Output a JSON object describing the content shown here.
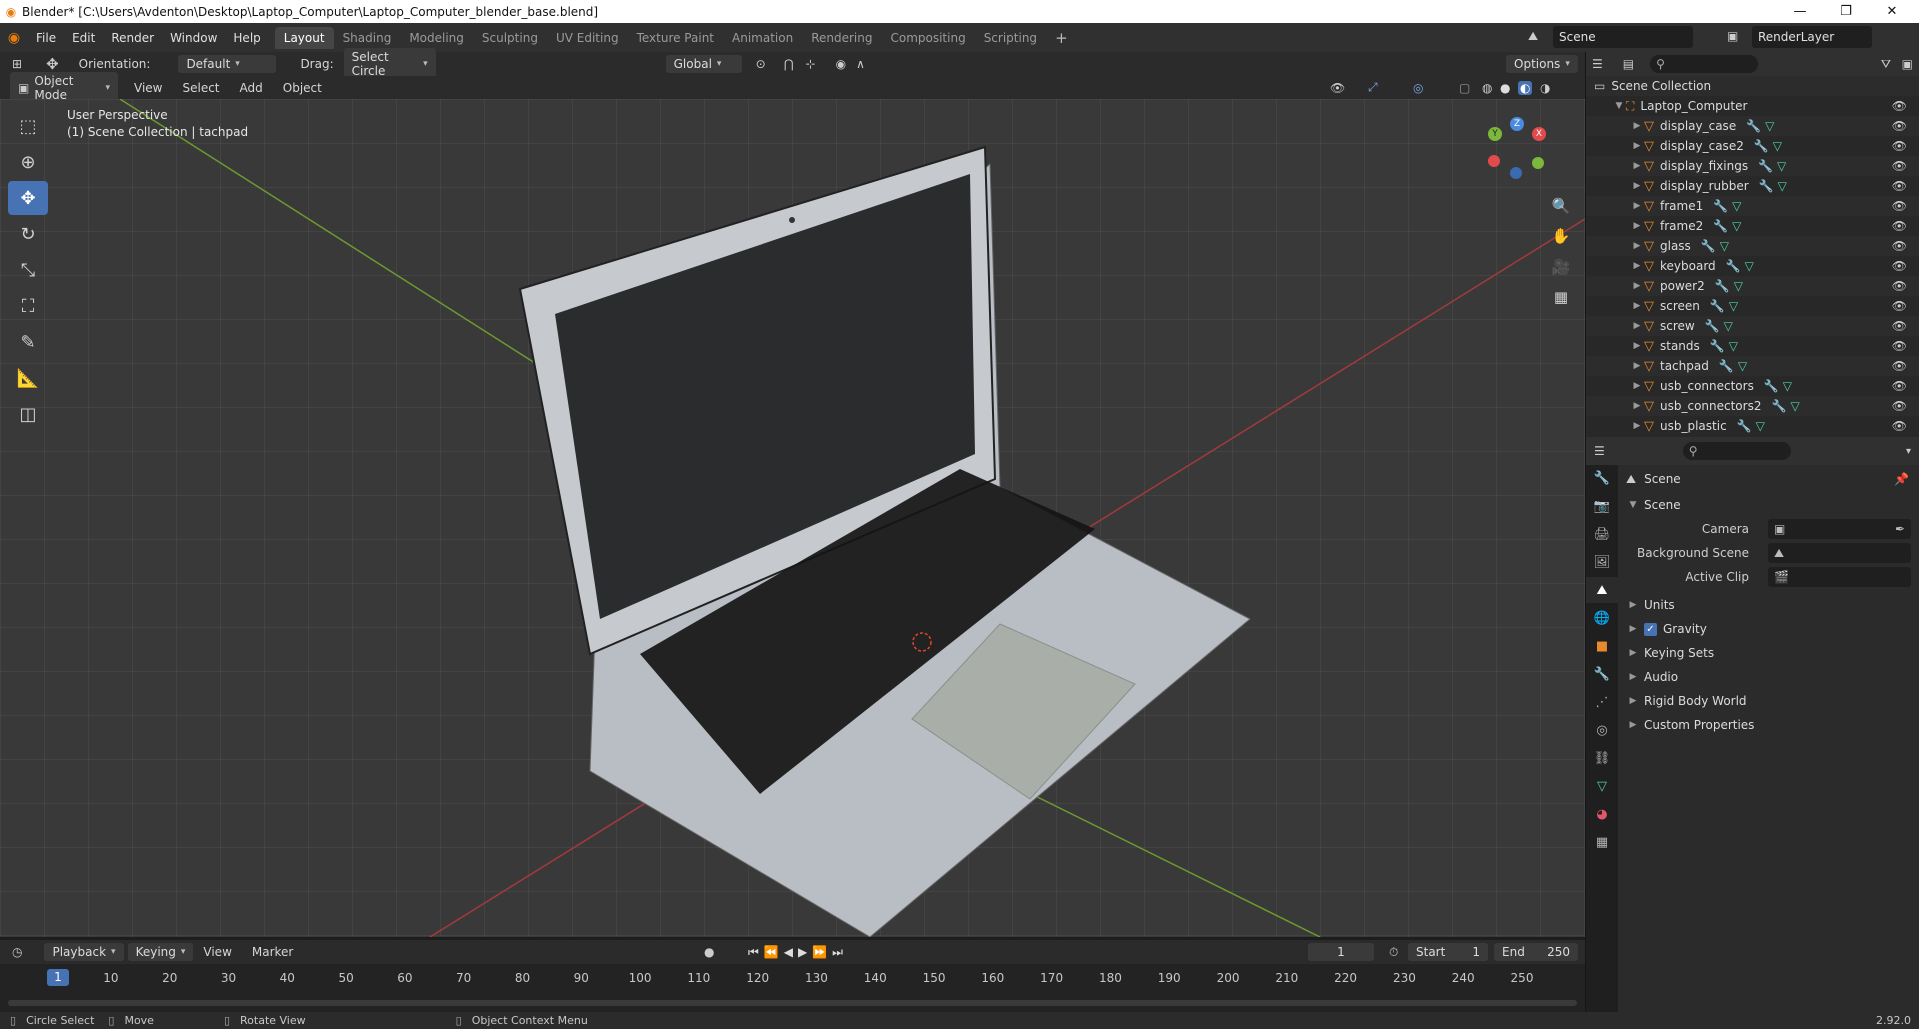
{
  "window": {
    "title": "Blender* [C:\\Users\\Avdenton\\Desktop\\Laptop_Computer\\Laptop_Computer_blender_base.blend]",
    "minimize": "—",
    "maximize": "❐",
    "close": "✕"
  },
  "menu": [
    "File",
    "Edit",
    "Render",
    "Window",
    "Help"
  ],
  "workspaces": [
    "Layout",
    "Shading",
    "Modeling",
    "Sculpting",
    "UV Editing",
    "Texture Paint",
    "Animation",
    "Rendering",
    "Compositing",
    "Scripting"
  ],
  "active_workspace": "Layout",
  "scene_name": "Scene",
  "render_layer": "RenderLayer",
  "tool_header": {
    "orientation_label": "Orientation:",
    "orientation_value": "Default",
    "drag_label": "Drag:",
    "drag_value": "Select Circle",
    "transform_orientation": "Global",
    "options": "Options"
  },
  "viewport_header": {
    "mode": "Object Mode",
    "menus": [
      "View",
      "Select",
      "Add",
      "Object"
    ]
  },
  "viewport": {
    "perspective": "User Perspective",
    "collection_info": "(1) Scene Collection | tachpad",
    "axis_x": "X",
    "axis_y": "Y",
    "axis_z": "Z"
  },
  "outliner": {
    "root": "Scene Collection",
    "collection": "Laptop_Computer",
    "objects": [
      "display_case",
      "display_case2",
      "display_fixings",
      "display_rubber",
      "frame1",
      "frame2",
      "glass",
      "keyboard",
      "power2",
      "screen",
      "screw",
      "stands",
      "tachpad",
      "usb_connectors",
      "usb_connectors2",
      "usb_plastic"
    ]
  },
  "properties": {
    "context": "Scene",
    "panel": "Scene",
    "fields": [
      {
        "label": "Camera",
        "value": ""
      },
      {
        "label": "Background Scene",
        "value": ""
      },
      {
        "label": "Active Clip",
        "value": ""
      }
    ],
    "panels": [
      "Units",
      "Gravity",
      "Keying Sets",
      "Audio",
      "Rigid Body World",
      "Custom Properties"
    ],
    "gravity_checked": true
  },
  "timeline": {
    "menus": [
      "Playback",
      "Keying",
      "View",
      "Marker"
    ],
    "current_frame": "1",
    "start_label": "Start",
    "start": "1",
    "end_label": "End",
    "end": "250",
    "ticks": [
      "1",
      "10",
      "20",
      "30",
      "40",
      "50",
      "60",
      "70",
      "80",
      "90",
      "100",
      "110",
      "120",
      "130",
      "140",
      "150",
      "160",
      "170",
      "180",
      "190",
      "200",
      "210",
      "220",
      "230",
      "240",
      "250"
    ]
  },
  "statusbar": {
    "items": [
      "Circle Select",
      "Move",
      "Rotate View",
      "Object Context Menu"
    ],
    "version": "2.92.0"
  },
  "colors": {
    "accent": "#4772b3",
    "mesh_icon": "#e8892b",
    "x_axis": "#e24b4b",
    "y_axis": "#7bb83c",
    "z_axis": "#4a8be0"
  }
}
